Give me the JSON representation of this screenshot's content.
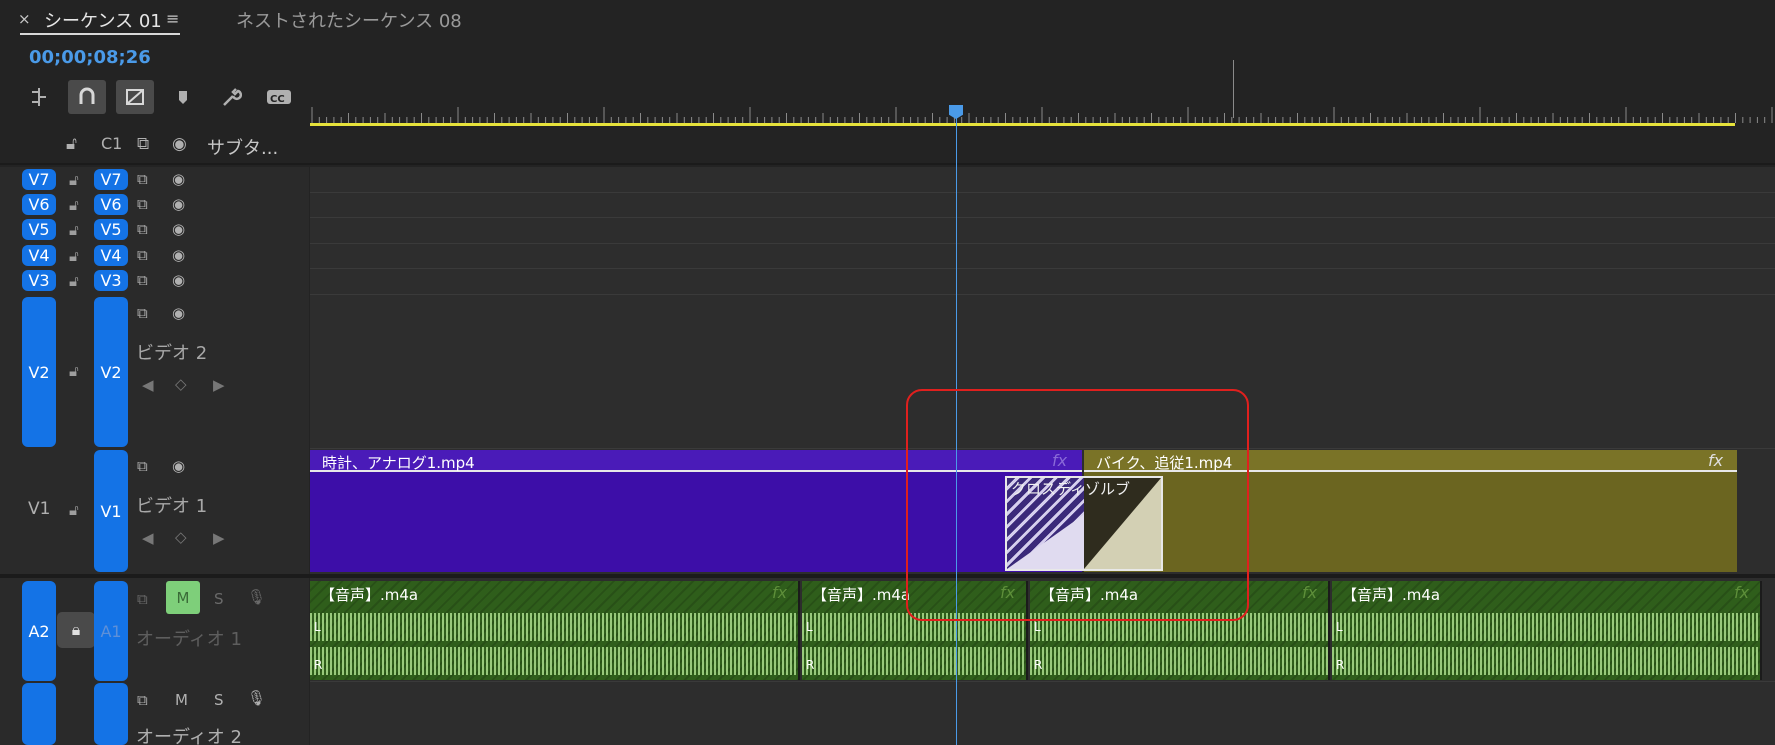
{
  "tabs": {
    "close": "×",
    "active": "シーケンス 01",
    "menu": "≡",
    "inactive": "ネストされたシーケンス 08"
  },
  "timecode": "00;00;08;26",
  "header_row": {
    "c1": "C1",
    "subtitle": "サブタ..."
  },
  "video_tracks": [
    {
      "src": "V7",
      "tgt": "V7"
    },
    {
      "src": "V6",
      "tgt": "V6"
    },
    {
      "src": "V5",
      "tgt": "V5"
    },
    {
      "src": "V4",
      "tgt": "V4"
    },
    {
      "src": "V3",
      "tgt": "V3"
    },
    {
      "src": "V2",
      "tgt": "V2",
      "name": "ビデオ 2"
    },
    {
      "src": "V1",
      "tgt": "V1",
      "name": "ビデオ 1"
    }
  ],
  "audio_tracks": [
    {
      "src": "A2",
      "tgt": "A1",
      "name": "オーディオ 1",
      "m": "M",
      "s": "S"
    },
    {
      "name": "オーディオ 2",
      "m": "M",
      "s": "S"
    }
  ],
  "clips": {
    "v1_a": "時計、アナログ1.mp4",
    "v1_b": "バイク、追従1.mp4",
    "transition": "クロスディゾルブ",
    "fx": "fx",
    "audio": [
      "【音声】.m4a",
      "【音声】.m4a",
      "【音声】.m4a",
      "【音声】.m4a"
    ],
    "channel_l": "L",
    "channel_r": "R"
  },
  "colors": {
    "accent": "#1473e6",
    "playhead": "#4a9ae8",
    "clip_purple": "#3d0ea8",
    "clip_olive": "#6b6520",
    "audio_green": "#2f5e1b",
    "workarea": "#e6e23b",
    "highlight": "#e0201e"
  }
}
